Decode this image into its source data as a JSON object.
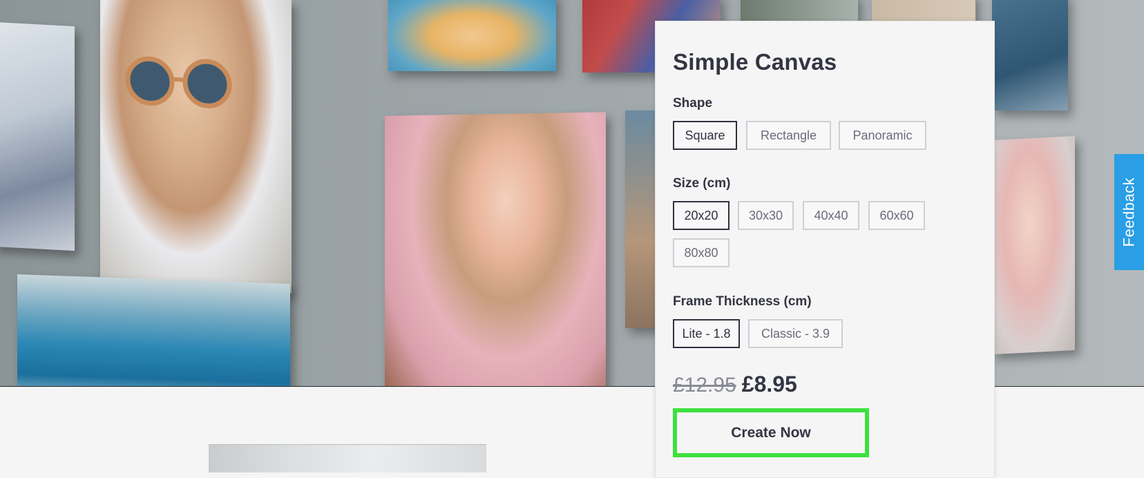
{
  "product": {
    "title": "Simple Canvas",
    "shape": {
      "label": "Shape",
      "options": [
        "Square",
        "Rectangle",
        "Panoramic"
      ],
      "selected": "Square"
    },
    "size": {
      "label": "Size (cm)",
      "options": [
        "20x20",
        "30x30",
        "40x40",
        "60x60",
        "80x80"
      ],
      "selected": "20x20"
    },
    "frame": {
      "label": "Frame Thickness (cm)",
      "options": [
        "Lite - 1.8",
        "Classic - 3.9"
      ],
      "selected": "Lite - 1.8"
    },
    "price": {
      "old": "£12.95",
      "new": "£8.95"
    },
    "cta_label": "Create Now"
  },
  "feedback_label": "Feedback",
  "colors": {
    "accent_cta_border": "#3ee03e",
    "feedback_bg": "#2a9ee6",
    "text_dark": "#333541"
  }
}
